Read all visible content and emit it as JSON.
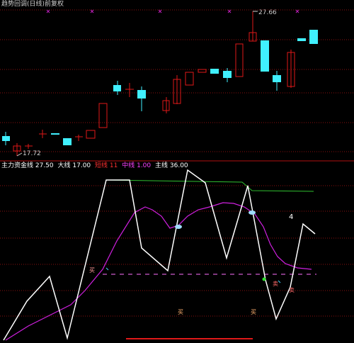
{
  "main_panel": {
    "title": "趋势回调(日线)前复权",
    "high_label": "27.66",
    "low_label": "17.72"
  },
  "indicator_panel": {
    "legend": [
      {
        "label": "主力资金线 27.50",
        "color": "#ffffff"
      },
      {
        "label": "大线 17.00",
        "color": "#ffffff"
      },
      {
        "label": "短线 11",
        "color": "#ff3030"
      },
      {
        "label": "中线 1.00",
        "color": "#ff40ff"
      },
      {
        "label": "主线 36.00",
        "color": "#ffffff"
      }
    ],
    "marks": [
      "买",
      "卖",
      "买",
      "买",
      "卖",
      "4"
    ]
  },
  "colors": {
    "up": "#e01818",
    "down": "#40f0ff",
    "grid": "#8a1010",
    "white_line": "#ffffff",
    "magenta_line": "#d020e0",
    "green_line": "#30c030"
  }
}
